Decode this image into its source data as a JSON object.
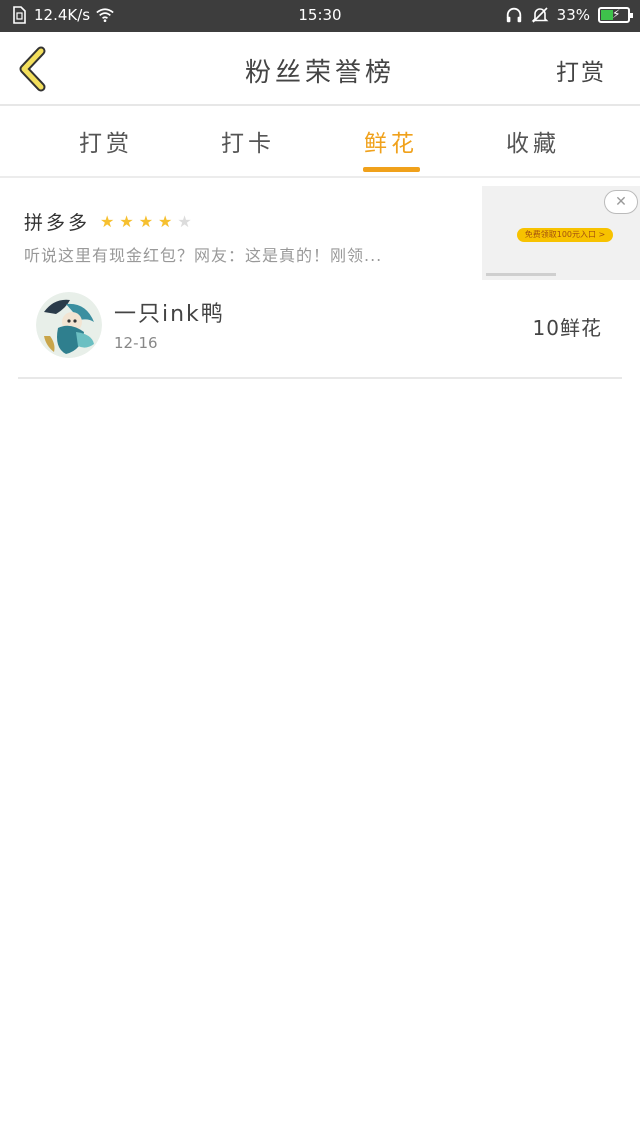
{
  "status_bar": {
    "speed": "12.4K/s",
    "time": "15:30",
    "battery": "33%",
    "icons": [
      "sim-icon",
      "wifi-icon",
      "headphone-icon",
      "bell-off-icon",
      "battery-icon"
    ]
  },
  "header": {
    "title": "粉丝荣誉榜",
    "action": "打赏"
  },
  "tabs": [
    {
      "label": "打赏"
    },
    {
      "label": "打卡"
    },
    {
      "label": "鲜花",
      "active": true
    },
    {
      "label": "收藏"
    }
  ],
  "ad": {
    "title": "拼多多",
    "rating": 4,
    "rating_max": 5,
    "description": "听说这里有现金红包？网友：这是真的！刚领...",
    "image_cta": "免费领取100元入口 >"
  },
  "leaderboard": [
    {
      "name": "一只ink鸭",
      "date": "12-16",
      "count": "10鲜花"
    }
  ],
  "colors": {
    "accent": "#f0a11b",
    "status_bar": "#3d3d3d",
    "star": "#f6c030",
    "back_arrow": "#f3df5c"
  }
}
